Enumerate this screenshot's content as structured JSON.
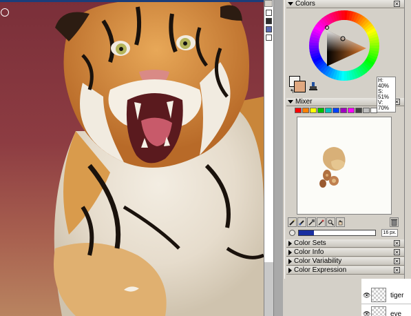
{
  "canvas": {
    "background_color": "#7a2f39"
  },
  "colors_panel": {
    "title": "Colors",
    "hsv": {
      "h": "H: 40%",
      "s": "S: 51%",
      "v": "V: 70%"
    },
    "primary_color": "#e0a880",
    "secondary_color": "#f4f2ee"
  },
  "mixer_panel": {
    "title": "Mixer",
    "strip_colors": [
      "#ff0000",
      "#ff8000",
      "#ffff00",
      "#00c000",
      "#00c0c0",
      "#0040ff",
      "#a000c0",
      "#ff00ff",
      "#404040",
      "#c0c0c0",
      "#ffffff"
    ],
    "brush_size": "16 px."
  },
  "collapsed_panels": [
    {
      "label": "Color Sets"
    },
    {
      "label": "Color Info"
    },
    {
      "label": "Color Variability"
    },
    {
      "label": "Color Expression"
    }
  ],
  "layers": [
    {
      "name": "tiger"
    },
    {
      "name": "eye"
    }
  ]
}
